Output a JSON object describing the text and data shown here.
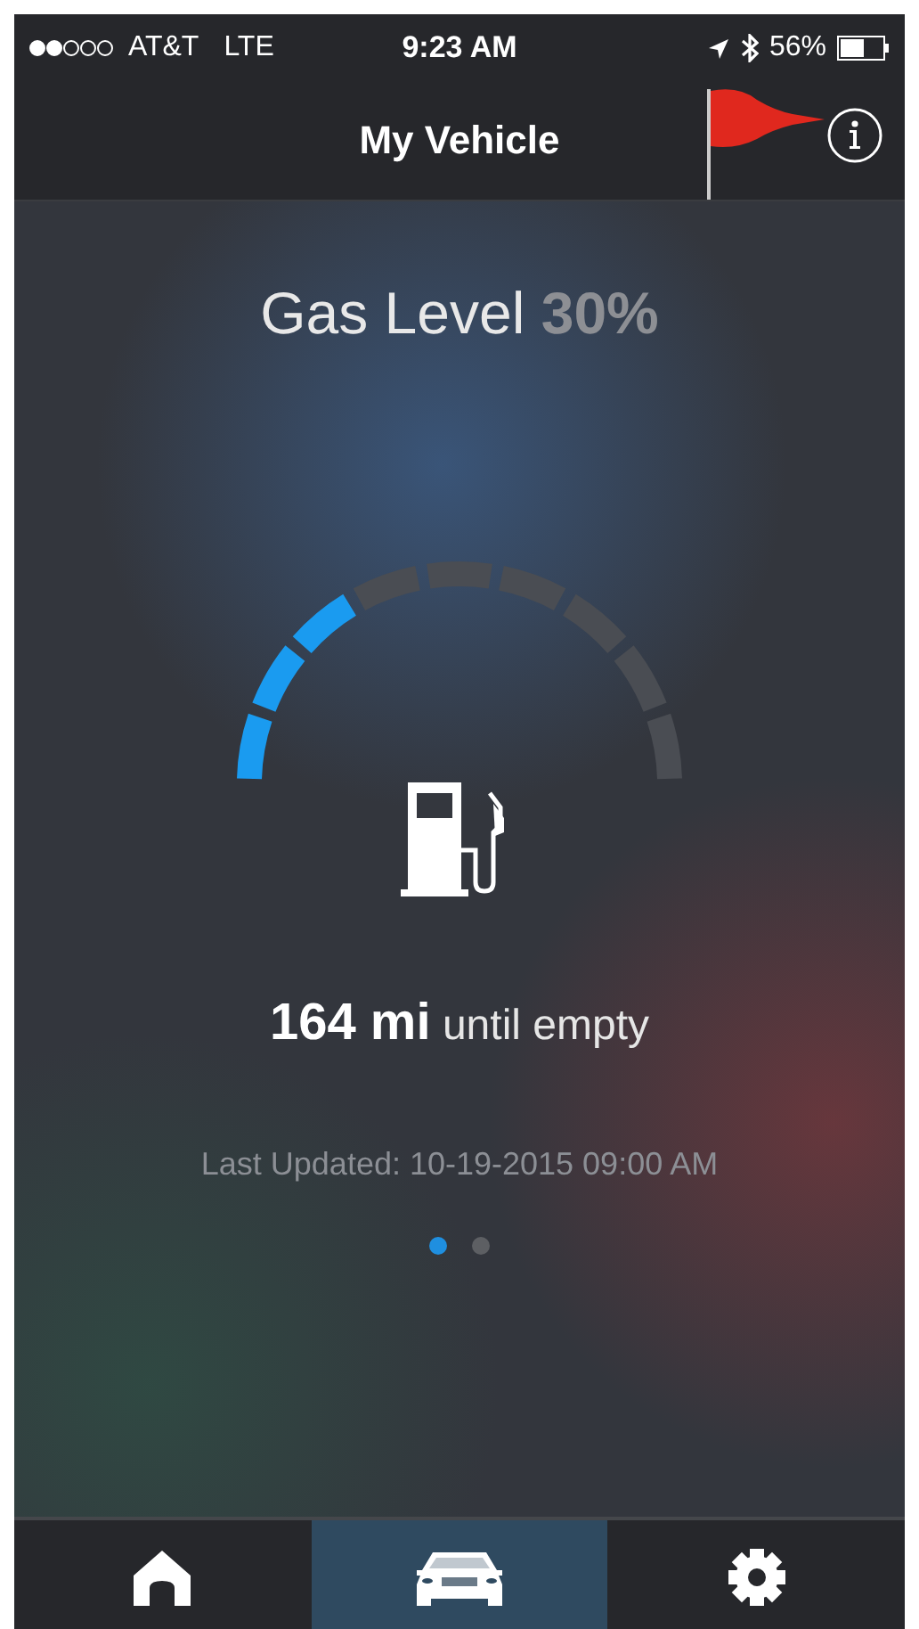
{
  "status_bar": {
    "carrier": "AT&T",
    "network": "LTE",
    "time": "9:23 AM",
    "battery": "56%"
  },
  "nav_bar": {
    "title": "My Vehicle"
  },
  "gas": {
    "label": "Gas Level",
    "percent": "30%",
    "level": 0.3
  },
  "range": {
    "value": "164 mi",
    "suffix": "until empty"
  },
  "last_updated": "Last Updated: 10-19-2015 09:00 AM",
  "pages": [
    {
      "selected": true
    },
    {
      "selected": false
    }
  ],
  "tabs": [
    {
      "kind": "home",
      "selected": false
    },
    {
      "kind": "car",
      "selected": true
    },
    {
      "kind": "settings",
      "selected": false
    }
  ]
}
